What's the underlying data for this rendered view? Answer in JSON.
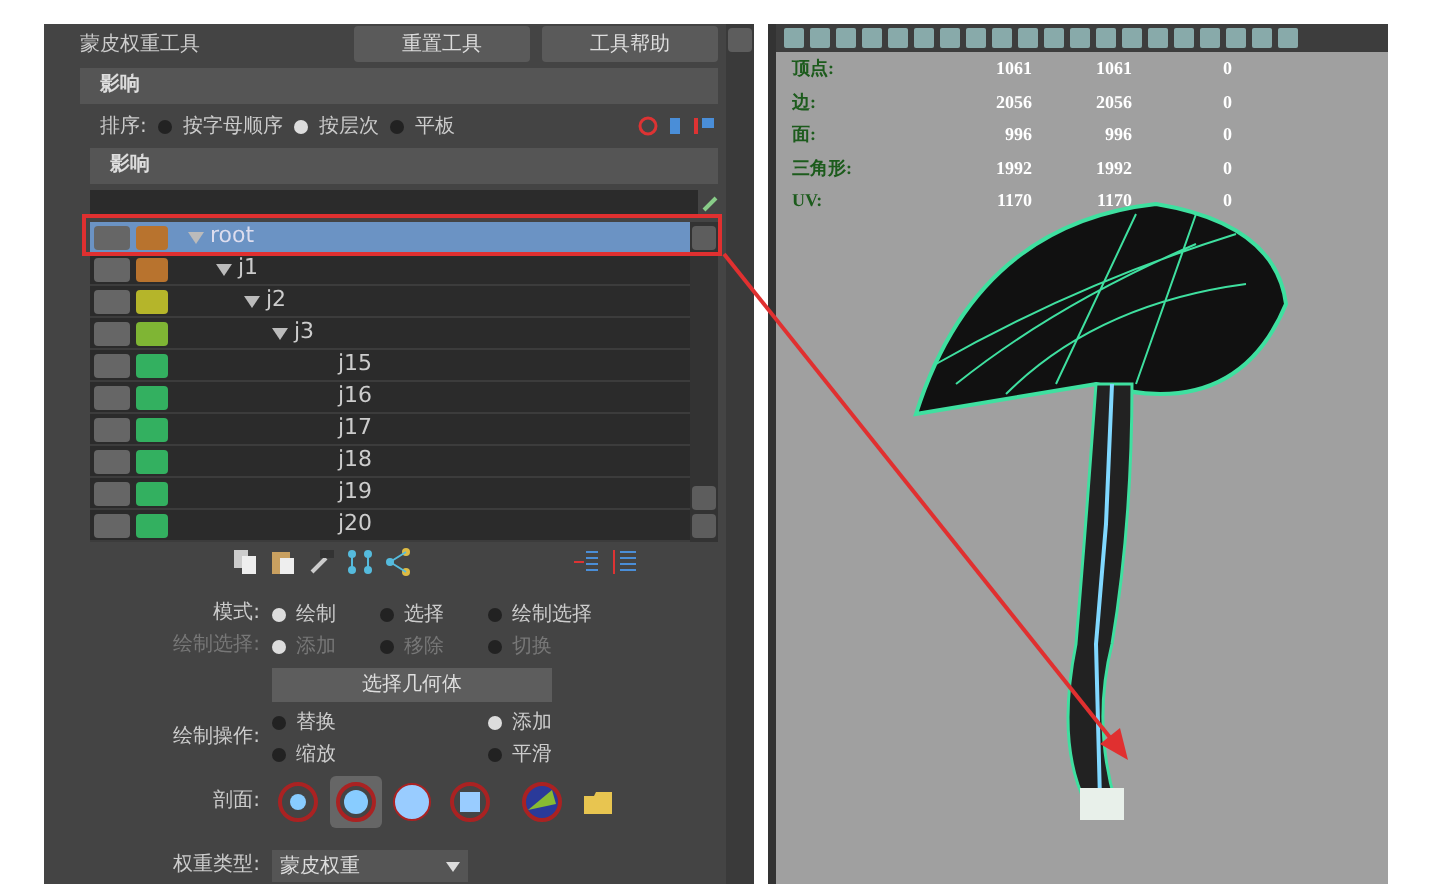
{
  "window": {
    "title": "蒙皮权重工具",
    "buttons": [
      "重置工具",
      "工具帮助"
    ]
  },
  "influence_section": {
    "header": "影响",
    "sort_label": "排序:",
    "sort_options": [
      {
        "label": "按字母顺序",
        "selected": false
      },
      {
        "label": "按层次",
        "selected": true
      },
      {
        "label": "平板",
        "selected": false
      }
    ],
    "list_header": "影响",
    "influences": [
      {
        "name": "root",
        "color": "#b8732e",
        "selected": true,
        "expanded": true,
        "children": [
          {
            "name": "j1",
            "color": "#b8732e",
            "selected": false,
            "expanded": true,
            "children": [
              {
                "name": "j2",
                "color": "#b5b52a",
                "selected": false,
                "expanded": true,
                "children": [
                  {
                    "name": "j3",
                    "color": "#7fb534",
                    "selected": false,
                    "expanded": true,
                    "children": [
                      {
                        "name": "j15",
                        "color": "#33b060",
                        "selected": false
                      },
                      {
                        "name": "j16",
                        "color": "#33b060",
                        "selected": false
                      },
                      {
                        "name": "j17",
                        "color": "#33b060",
                        "selected": false
                      },
                      {
                        "name": "j18",
                        "color": "#33b060",
                        "selected": false
                      },
                      {
                        "name": "j19",
                        "color": "#33b060",
                        "selected": false
                      },
                      {
                        "name": "j20",
                        "color": "#33b060",
                        "selected": false
                      }
                    ]
                  }
                ]
              }
            ]
          }
        ]
      }
    ]
  },
  "paint": {
    "mode_label": "模式:",
    "modes": [
      {
        "label": "绘制",
        "selected": true
      },
      {
        "label": "选择",
        "selected": false
      },
      {
        "label": "绘制选择",
        "selected": false
      }
    ],
    "paint_select_label": "绘制选择:",
    "paint_select_disabled": true,
    "paint_select": [
      {
        "label": "添加",
        "selected": true
      },
      {
        "label": "移除",
        "selected": false
      },
      {
        "label": "切换",
        "selected": false
      }
    ],
    "select_geometry_button": "选择几何体",
    "operation_label": "绘制操作:",
    "operations": [
      {
        "label": "替换",
        "selected": false
      },
      {
        "label": "添加",
        "selected": true
      },
      {
        "label": "缩放",
        "selected": false
      },
      {
        "label": "平滑",
        "selected": false
      }
    ],
    "profile_label": "剖面:",
    "profiles": [
      {
        "kind": "soft",
        "selected": false
      },
      {
        "kind": "gaussian",
        "selected": true
      },
      {
        "kind": "solid",
        "selected": false
      },
      {
        "kind": "square",
        "selected": false
      },
      {
        "kind": "image",
        "selected": false
      }
    ],
    "weight_type_label": "权重类型:",
    "weight_type": "蒙皮权重"
  },
  "viewport": {
    "stats": [
      {
        "label": "顶点:",
        "values": [
          "1061",
          "1061",
          "0"
        ]
      },
      {
        "label": "边:",
        "values": [
          "2056",
          "2056",
          "0"
        ]
      },
      {
        "label": "面:",
        "values": [
          "996",
          "996",
          "0"
        ]
      },
      {
        "label": "三角形:",
        "values": [
          "1992",
          "1992",
          "0"
        ]
      },
      {
        "label": "UV:",
        "values": [
          "1170",
          "1170",
          "0"
        ]
      }
    ]
  }
}
